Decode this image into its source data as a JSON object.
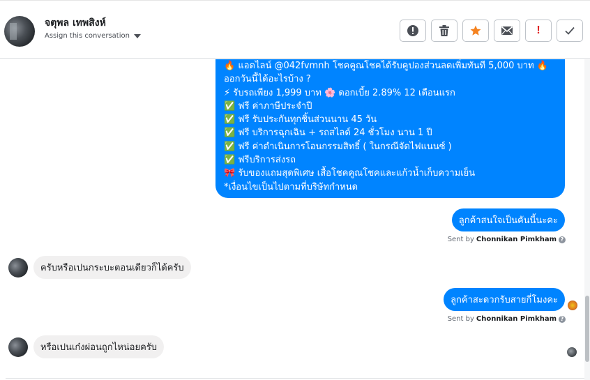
{
  "header": {
    "contact_name": "จตุพล เทพสิงห์",
    "assign_label": "Assign this conversation",
    "toolbar": [
      {
        "name": "spam-button",
        "icon": "alert-circle-icon"
      },
      {
        "name": "delete-button",
        "icon": "trash-icon"
      },
      {
        "name": "star-button",
        "icon": "star-icon"
      },
      {
        "name": "mark-unread-button",
        "icon": "envelope-icon"
      },
      {
        "name": "important-button",
        "icon": "exclamation-icon",
        "label": "!"
      },
      {
        "name": "done-button",
        "icon": "checkmark-icon"
      }
    ]
  },
  "messages": {
    "promo_lines": [
      "🔥 แอดไลน์ @042fvmnh โชคคูณโชคได้รับคูปองส่วนลดเพิ่มทันที 5,000 บาท 🔥",
      "ออกวันนี้ได้อะไรบ้าง ?",
      "⚡ รับรถเพียง 1,999 บาท 🌸 ดอกเบี้ย 2.89% 12 เดือนแรก",
      "✅ ฟรี ค่าภาษีประจำปี",
      "✅ ฟรี รับประกันทุกชิ้นส่วนนาน 45 วัน",
      "✅ ฟรี บริการฉุกเฉิน + รถสไลด์ 24 ชั่วโมง นาน 1 ปี",
      "✅ ฟรี ค่าดำเนินการโอนกรรมสิทธิ์ ( ในกรณีจัดไฟแนนซ์ )",
      "✅ ฟรีบริการส่งรถ",
      "🎀 รับของแถมสุดพิเศษ เสื้อโชคคูณโชคและแก้วน้ำเก็บความเย็น",
      "*เงื่อนไขเป็นไปตามที่บริษัทกำหนด"
    ],
    "out1": "ลูกค้าสนใจเป็นคันนี้นะคะ",
    "in1": "ครับหรือเปนกระบะตอนเดียวก็ได้ครับ",
    "out2": "ลูกค้าสะดวกรับสายกี่โมงคะ",
    "in2": "หรือเปนเก๋งผ่อนถูกไหน่อยครับ",
    "sent_by_prefix": "Sent by",
    "sender": "Chonnikan Pimkham",
    "help_glyph": "?"
  },
  "colors": {
    "outgoing_bubble": "#0084ff",
    "incoming_bubble": "#f1f0f0",
    "star": "#f5821f",
    "important": "#e02424"
  }
}
